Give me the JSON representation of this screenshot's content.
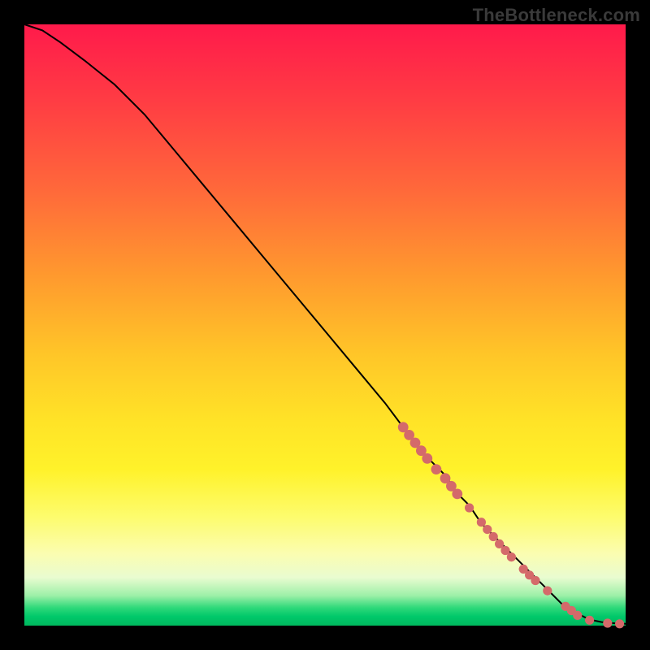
{
  "watermark": "TheBottleneck.com",
  "gradient_colors": {
    "top": "#ff1a4b",
    "mid1": "#ff9a2e",
    "mid2": "#ffe327",
    "light": "#fbfdb0",
    "bottom": "#00c86a"
  },
  "marker_color": "#d46a6a",
  "curve_color": "#000000",
  "chart_data": {
    "type": "line",
    "title": "",
    "xlabel": "",
    "ylabel": "",
    "xlim": [
      0,
      100
    ],
    "ylim": [
      0,
      100
    ],
    "grid": false,
    "series": [
      {
        "name": "curve",
        "x": [
          0,
          3,
          6,
          10,
          15,
          20,
          25,
          30,
          35,
          40,
          45,
          50,
          55,
          60,
          63,
          66,
          68,
          70,
          72,
          74,
          76,
          78,
          80,
          82,
          84,
          86,
          88,
          90,
          92,
          94,
          96,
          98,
          100
        ],
        "y": [
          100,
          99,
          97,
          94,
          90,
          85,
          79,
          73,
          67,
          61,
          55,
          49,
          43,
          37,
          33,
          29,
          27,
          25,
          22,
          20,
          17,
          15,
          13,
          11,
          9,
          7,
          5,
          3,
          2,
          1,
          0.6,
          0.4,
          0.3
        ]
      }
    ],
    "markers": [
      {
        "x": 63,
        "y": 33,
        "size": 4
      },
      {
        "x": 64,
        "y": 31.7,
        "size": 4
      },
      {
        "x": 65,
        "y": 30.4,
        "size": 4
      },
      {
        "x": 66,
        "y": 29.1,
        "size": 4
      },
      {
        "x": 67,
        "y": 27.8,
        "size": 4
      },
      {
        "x": 68.5,
        "y": 26.0,
        "size": 4
      },
      {
        "x": 70,
        "y": 24.5,
        "size": 4
      },
      {
        "x": 71,
        "y": 23.2,
        "size": 4
      },
      {
        "x": 72,
        "y": 21.9,
        "size": 4
      },
      {
        "x": 74,
        "y": 19.6,
        "size": 3.5
      },
      {
        "x": 76,
        "y": 17.2,
        "size": 3.5
      },
      {
        "x": 77,
        "y": 16.0,
        "size": 3.5
      },
      {
        "x": 78,
        "y": 14.8,
        "size": 3.5
      },
      {
        "x": 79,
        "y": 13.6,
        "size": 3.5
      },
      {
        "x": 80,
        "y": 12.5,
        "size": 3.5
      },
      {
        "x": 81,
        "y": 11.4,
        "size": 3.5
      },
      {
        "x": 83,
        "y": 9.4,
        "size": 3.5
      },
      {
        "x": 84,
        "y": 8.4,
        "size": 3.5
      },
      {
        "x": 85,
        "y": 7.5,
        "size": 3.5
      },
      {
        "x": 87,
        "y": 5.8,
        "size": 3.5
      },
      {
        "x": 90,
        "y": 3.2,
        "size": 3.5
      },
      {
        "x": 91,
        "y": 2.5,
        "size": 3.5
      },
      {
        "x": 92,
        "y": 1.7,
        "size": 3.5
      },
      {
        "x": 94,
        "y": 0.9,
        "size": 3.5
      },
      {
        "x": 97,
        "y": 0.4,
        "size": 3.5
      },
      {
        "x": 99,
        "y": 0.3,
        "size": 3.5
      }
    ]
  }
}
